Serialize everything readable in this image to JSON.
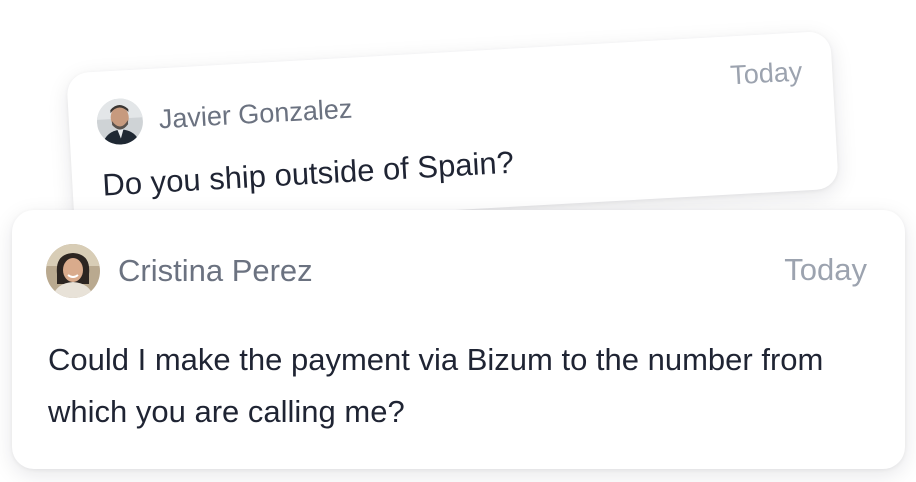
{
  "messages": [
    {
      "author": "Javier Gonzalez",
      "time": "Today",
      "text": "Do you ship outside of Spain?",
      "avatar_icon": "avatar-photo-man"
    },
    {
      "author": "Cristina Perez",
      "time": "Today",
      "text": "Could I make the payment via Bizum to the number from which you are calling me?",
      "avatar_icon": "avatar-photo-woman"
    }
  ],
  "colors": {
    "name": "#6b7280",
    "time": "#9ca3af",
    "message": "#1f2433",
    "card_bg": "#ffffff"
  }
}
